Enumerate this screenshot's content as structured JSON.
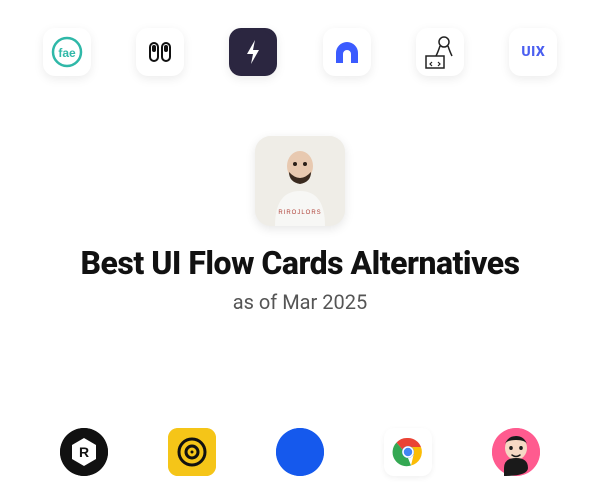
{
  "top_icons": [
    {
      "name": "fae",
      "label": "fae"
    },
    {
      "name": "pills"
    },
    {
      "name": "bolt"
    },
    {
      "name": "arch"
    },
    {
      "name": "dev-sketch"
    },
    {
      "name": "uix",
      "label": "UIX"
    }
  ],
  "hero": {
    "title": "Best UI Flow Cards Alternatives",
    "subtitle": "as of Mar 2025"
  },
  "bottom_icons": [
    {
      "name": "hex-r"
    },
    {
      "name": "yellow-target"
    },
    {
      "name": "blue-circle"
    },
    {
      "name": "chrome"
    },
    {
      "name": "face-pink"
    }
  ]
}
